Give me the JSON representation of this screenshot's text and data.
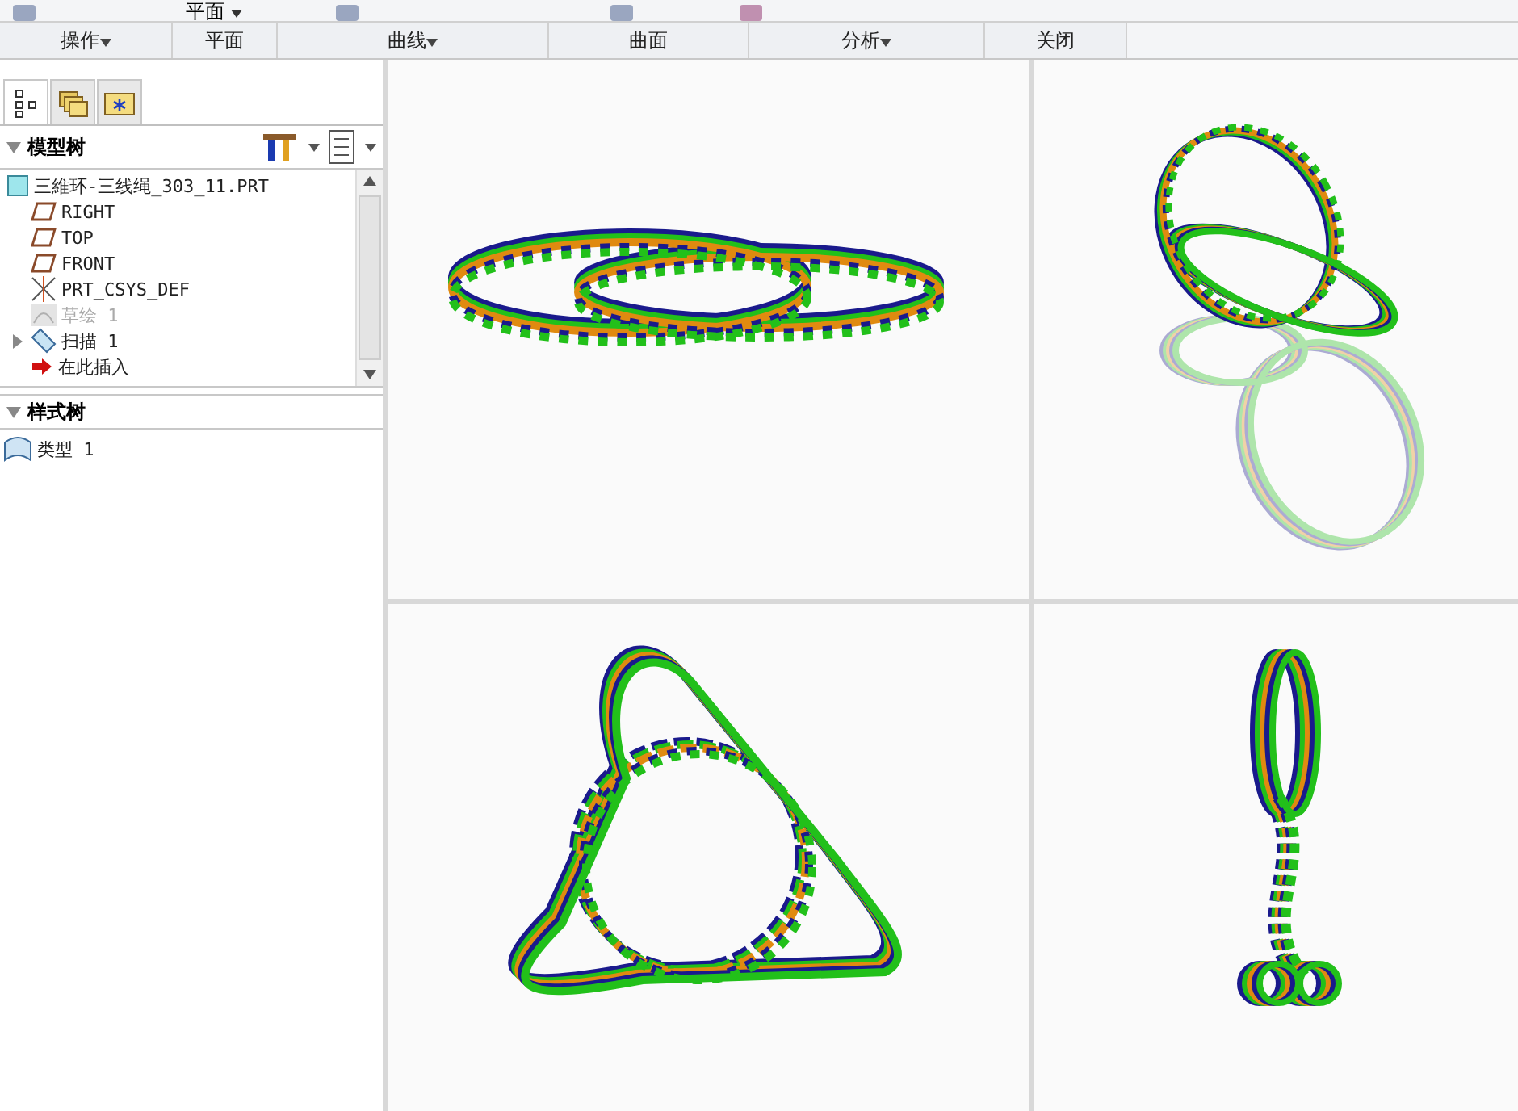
{
  "ribbon": {
    "plane_dropdown": {
      "label": "平面"
    },
    "groups": [
      {
        "label": "操作",
        "dropdown": true
      },
      {
        "label": "平面",
        "dropdown": false
      },
      {
        "label": "曲线",
        "dropdown": true
      },
      {
        "label": "曲面",
        "dropdown": false
      },
      {
        "label": "分析",
        "dropdown": true
      },
      {
        "label": "关闭",
        "dropdown": false
      }
    ]
  },
  "panel": {
    "tabs": [
      {
        "kind": "tree",
        "selected": true
      },
      {
        "kind": "layers",
        "selected": false
      },
      {
        "kind": "favorites",
        "selected": false
      }
    ],
    "model_tree": {
      "title": "模型树",
      "expanded": true,
      "items": [
        {
          "label": "三維环-三线绳_303_11.PRT",
          "kind": "part",
          "children": [
            {
              "label": "RIGHT",
              "kind": "plane",
              "disabled": false
            },
            {
              "label": "TOP",
              "kind": "plane",
              "disabled": false
            },
            {
              "label": "FRONT",
              "kind": "plane",
              "disabled": false
            },
            {
              "label": "PRT_CSYS_DEF",
              "kind": "csys",
              "disabled": false
            },
            {
              "label": "草绘 1",
              "kind": "sketch",
              "disabled": true
            },
            {
              "label": "扫描 1",
              "kind": "sweep",
              "disabled": false,
              "expanded": false
            },
            {
              "label": "在此插入",
              "kind": "insert",
              "disabled": false
            }
          ]
        }
      ]
    },
    "style_tree": {
      "title": "样式树",
      "expanded": true,
      "items": [
        {
          "label": "类型 1"
        }
      ]
    }
  }
}
